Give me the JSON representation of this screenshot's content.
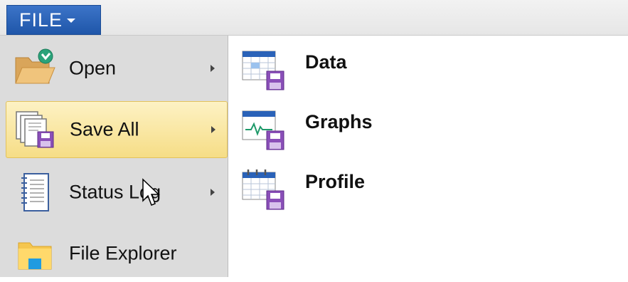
{
  "file_menu": {
    "label": "FILE",
    "items": [
      {
        "label": "Open",
        "icon": "folder-open-icon",
        "has_submenu": true,
        "selected": false
      },
      {
        "label": "Save All",
        "icon": "save-all-icon",
        "has_submenu": true,
        "selected": true
      },
      {
        "label": "Status Log",
        "icon": "notepad-icon",
        "has_submenu": true,
        "selected": false
      },
      {
        "label": "File Explorer",
        "icon": "file-explorer-icon",
        "has_submenu": false,
        "selected": false
      }
    ]
  },
  "submenu": {
    "items": [
      {
        "label": "Data",
        "icon": "data-save-icon"
      },
      {
        "label": "Graphs",
        "icon": "graphs-save-icon"
      },
      {
        "label": "Profile",
        "icon": "profile-save-icon"
      }
    ]
  },
  "colors": {
    "file_button": "#2a62b8",
    "selected_item": "#f8e39a",
    "menu_background": "#dcdcdc",
    "save_accent": "#8a4fb8"
  }
}
